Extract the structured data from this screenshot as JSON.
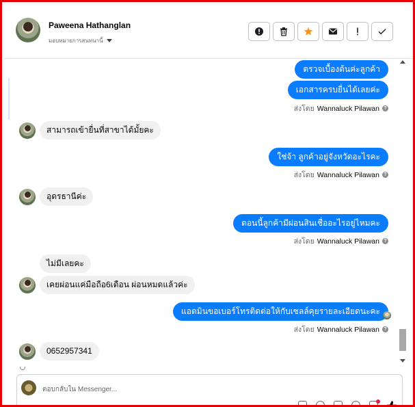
{
  "header": {
    "contact_name": "Paweena Hathanglan",
    "assign_label": "มอบหมายการสนทนานี้",
    "toolbar_icons": [
      "alert-circle-icon",
      "trash-icon",
      "star-icon",
      "mail-icon",
      "exclamation-icon",
      "check-icon"
    ],
    "star_color": "#f7931e"
  },
  "messages": {
    "m1": "ตรวจเบื้องต้นค่ะลูกค้า",
    "m2": "เอกสารครบยื่นได้เลยค่ะ",
    "in1": "สามารถเข้ายื่นที่สาขาได้มั้ยคะ",
    "m3": "ใช่จ้า ลูกค้าอยู่จังหวัดอะไรคะ",
    "in2": "อุดรธานีค่ะ",
    "m4": "ตอนนี้ลูกค้ามีผ่อนสินเชื่ออะไรอยู่ไหมคะ",
    "in3": "ไม่มีเลยคะ",
    "in4": "เคยผ่อนแค่มือถือ6เดือน ผ่อนหมดแล้วค่ะ",
    "m5": "แอดมินขอเบอร์โทรติดต่อให้กับเซลล์คุยรายละเอียดนะคะ",
    "in5": "0652957341"
  },
  "sent_by": {
    "prefix": "ส่งโดย",
    "name": "Wannaluck Pilawan"
  },
  "composer": {
    "placeholder": "ตอบกลับใน Messenger..."
  },
  "colors": {
    "outgoing_bubble": "#0a7cff",
    "incoming_bubble": "#f0f0f0",
    "frame_border": "#e60000"
  }
}
